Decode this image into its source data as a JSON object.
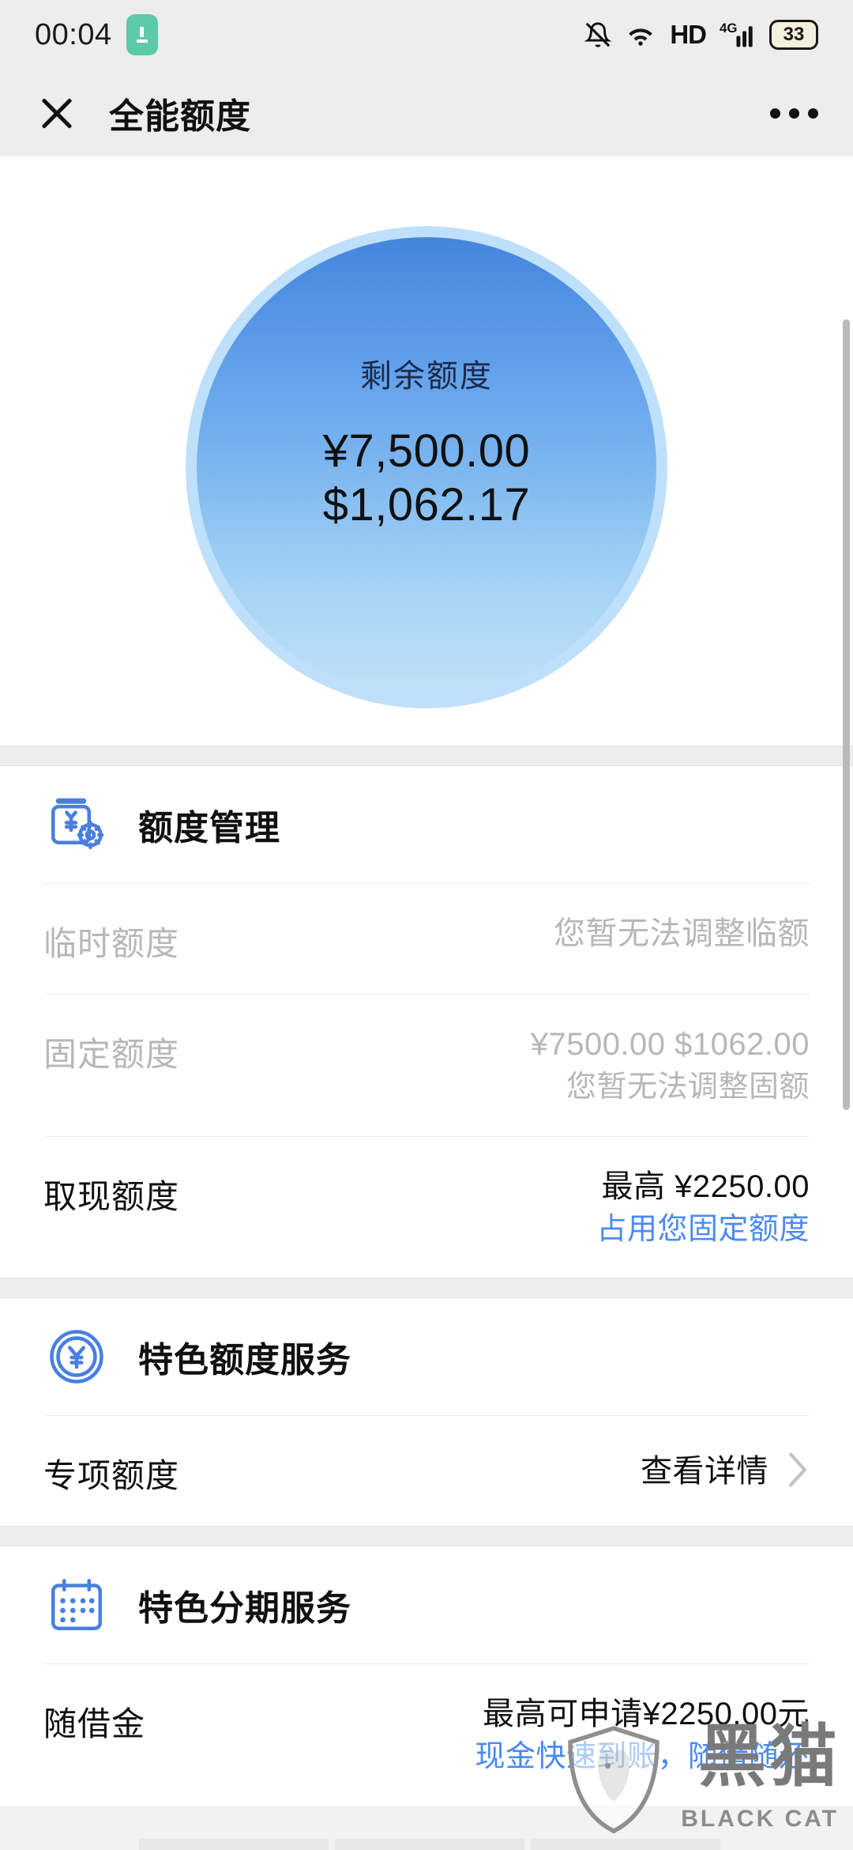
{
  "status_bar": {
    "time": "00:04",
    "app_badge_icon": "green-app-icon",
    "icons": [
      "bell-off-icon",
      "wifi-icon",
      "hd-icon",
      "signal-4g-icon",
      "battery-icon"
    ],
    "hd_label": "HD",
    "network_label": "4G",
    "battery_level": "33"
  },
  "header": {
    "close_icon": "close-icon",
    "title": "全能额度",
    "more_icon": "more-options-icon"
  },
  "hero": {
    "label": "剩余额度",
    "amount_cny": "¥7,500.00",
    "amount_usd": "$1,062.17"
  },
  "sections": [
    {
      "icon": "wallet-settings-icon",
      "title": "额度管理",
      "rows": [
        {
          "label": "临时额度",
          "value_primary": "您暂无法调整临额",
          "value_secondary": "",
          "muted": true,
          "link": false,
          "arrow": false
        },
        {
          "label": "固定额度",
          "value_primary": "¥7500.00 $1062.00",
          "value_secondary": "您暂无法调整固额",
          "muted": true,
          "link": false,
          "arrow": false
        },
        {
          "label": "取现额度",
          "value_primary": "最高 ¥2250.00",
          "value_secondary": "占用您固定额度",
          "muted": false,
          "link": true,
          "arrow": false
        }
      ]
    },
    {
      "icon": "yuan-coin-icon",
      "title": "特色额度服务",
      "rows": [
        {
          "label": "专项额度",
          "value_primary": "查看详情",
          "value_secondary": "",
          "muted": false,
          "link": true,
          "arrow": true
        }
      ]
    },
    {
      "icon": "calendar-icon",
      "title": "特色分期服务",
      "rows": [
        {
          "label": "随借金",
          "value_primary": "最高可申请¥2250.00元",
          "value_secondary": "现金快速到账，随借随还",
          "muted": false,
          "link": true,
          "arrow": false
        }
      ]
    }
  ],
  "watermark": {
    "logo_icon": "black-cat-shield-icon",
    "text": "黑猫",
    "subtext": "BLACK CAT"
  },
  "colors": {
    "accent_blue": "#4a8af4",
    "icon_blue": "#4a7fe0",
    "muted_gray": "#b7b7b7",
    "page_bg": "#f2f2f2",
    "chrome_bg": "#ededed"
  }
}
